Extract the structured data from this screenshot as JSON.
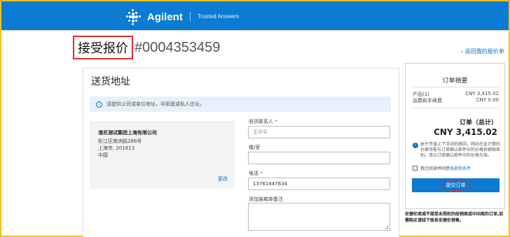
{
  "header": {
    "brand": "Agilent",
    "tagline": "Trusted Answers"
  },
  "page": {
    "title": "接受报价",
    "order_number": "#0004353459",
    "back_link": "‹  返回我的报价单"
  },
  "shipping": {
    "title": "送货地址",
    "info_text": "请提供公司或单位地址，非家庭或私人住址。",
    "address": {
      "company": "港尼测试集团上海有限公司",
      "street": "松江区南洲路288号",
      "city_zip": "上海市, 201613",
      "country": "中国"
    },
    "edit_label": "更改",
    "fields": {
      "contact_label": "收货联系人",
      "contact_value": "王中平",
      "building_label": "楼/室",
      "building_value": "",
      "phone_label": "电话",
      "phone_value": "13761447634",
      "note_label": "添加装箱单备注"
    }
  },
  "summary": {
    "title": "订单摘要",
    "products_label": "产品(1)",
    "products_value": "CNY 3,415.02",
    "shipping_label": "运费和手续费",
    "shipping_value": "CNY 0.00",
    "total_label": "订单（总计）",
    "total_value": "CNY 3,415.02",
    "notice": "由于币值上下浮动的原因，网站在此计算的价格可能与订单确认邮件中的价格有细微差别。请以订单确认邮件中的价格为准。",
    "terms_text": "我已阅读并同意",
    "terms_link": "条款和条件",
    "submit_label": "提交订单",
    "disclaimer": "安捷伦商城不接受未授权的经销商或中间商的订单,如需购买请线下联系安捷伦销售。"
  },
  "colors": {
    "brand_blue": "#0b7bd3",
    "highlight_red": "#e02b2b",
    "frame_yellow": "#f2c21b"
  }
}
